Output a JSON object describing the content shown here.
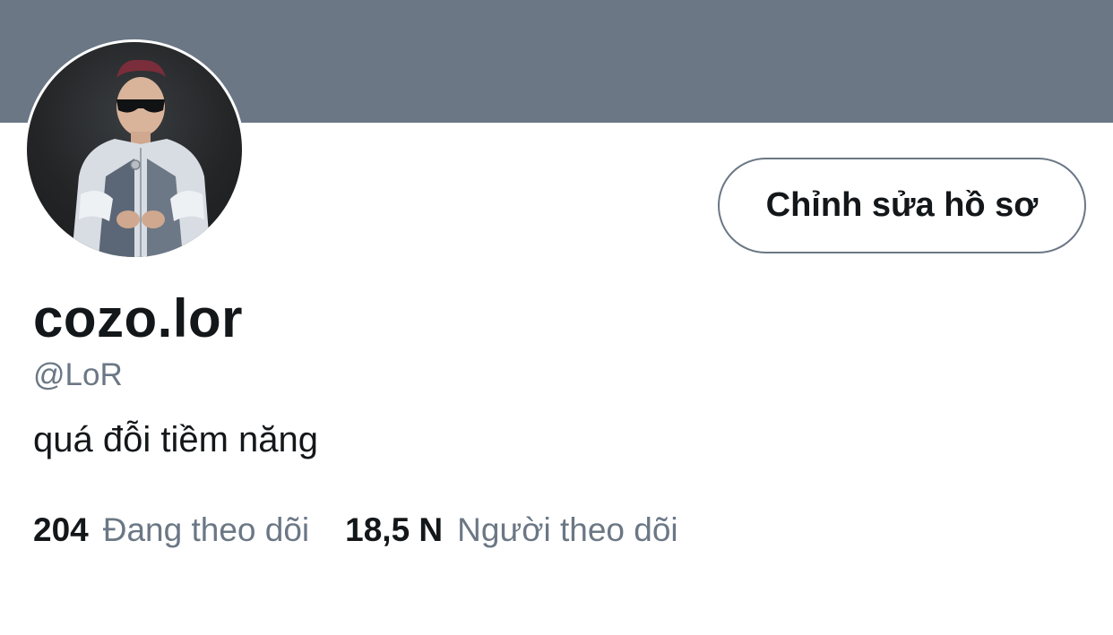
{
  "profile": {
    "display_name": "cozo.lor",
    "handle": "@LoR",
    "bio": "quá đỗi tiềm năng",
    "edit_button_label": "Chỉnh sửa hồ sơ",
    "avatar": "profile-photo"
  },
  "stats": {
    "following": {
      "count": "204",
      "label": "Đang theo dõi"
    },
    "followers": {
      "count": "18,5 N",
      "label": "Người theo dõi"
    }
  },
  "colors": {
    "banner": "#6b7785",
    "text_primary": "#14171a",
    "text_secondary": "#6b7785",
    "button_border": "#6b7785"
  }
}
